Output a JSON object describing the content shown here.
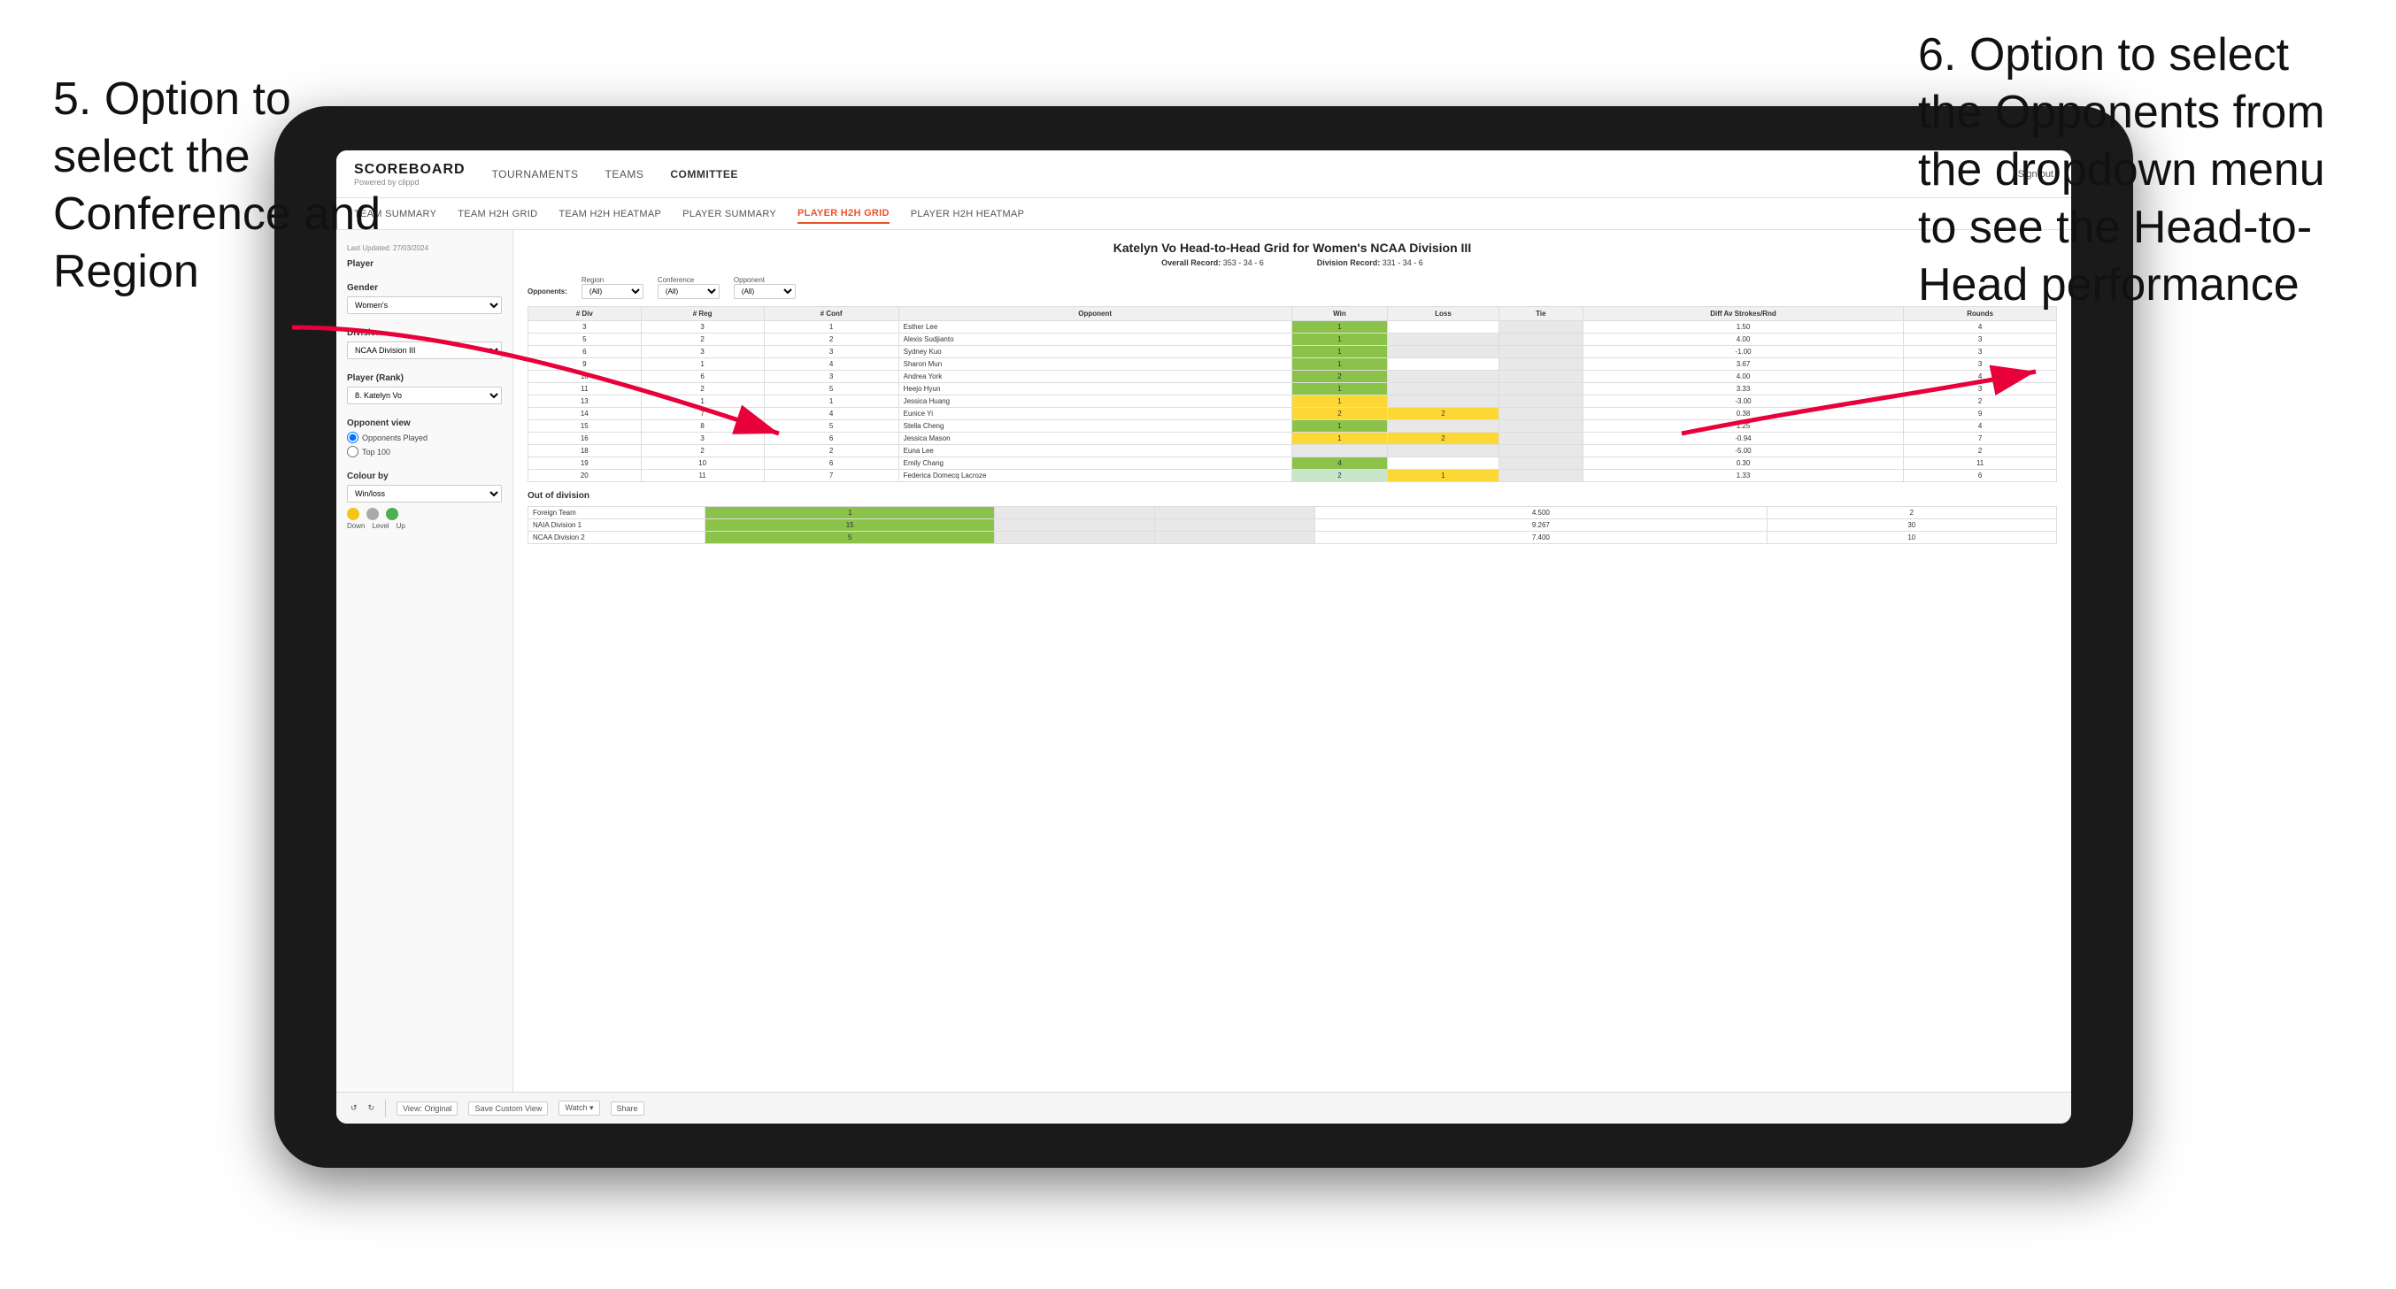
{
  "annotations": {
    "left": {
      "text": "5. Option to select the Conference and Region"
    },
    "right": {
      "text": "6. Option to select the Opponents from the dropdown menu to see the Head-to-Head performance"
    }
  },
  "nav": {
    "logo": "SCOREBOARD",
    "logo_sub": "Powered by clippd",
    "links": [
      "TOURNAMENTS",
      "TEAMS",
      "COMMITTEE"
    ],
    "active_link": "COMMITTEE",
    "sign_out": "Sign out"
  },
  "sub_nav": {
    "links": [
      "TEAM SUMMARY",
      "TEAM H2H GRID",
      "TEAM H2H HEATMAP",
      "PLAYER SUMMARY",
      "PLAYER H2H GRID",
      "PLAYER H2H HEATMAP"
    ],
    "active": "PLAYER H2H GRID"
  },
  "left_panel": {
    "last_updated_label": "Last Updated: 27/03/2024",
    "player_label": "Player",
    "gender_label": "Gender",
    "gender_value": "Women's",
    "division_label": "Division",
    "division_value": "NCAA Division III",
    "player_rank_label": "Player (Rank)",
    "player_rank_value": "8. Katelyn Vo",
    "opponent_view_label": "Opponent view",
    "radio_options": [
      "Opponents Played",
      "Top 100"
    ],
    "radio_selected": "Opponents Played",
    "colour_by_label": "Colour by",
    "colour_by_value": "Win/loss",
    "colour_labels": [
      "Down",
      "Level",
      "Up"
    ]
  },
  "data": {
    "title": "Katelyn Vo Head-to-Head Grid for Women's NCAA Division III",
    "overall_record_label": "Overall Record:",
    "overall_record": "353 - 34 - 6",
    "division_record_label": "Division Record:",
    "division_record": "331 - 34 - 6",
    "filter": {
      "opponents_label": "Opponents:",
      "region_label": "Region",
      "region_value": "(All)",
      "conference_label": "Conference",
      "conference_value": "(All)",
      "opponent_label": "Opponent",
      "opponent_value": "(All)"
    },
    "table_headers": [
      "# Div",
      "# Reg",
      "# Conf",
      "Opponent",
      "Win",
      "Loss",
      "Tie",
      "Diff Av Strokes/Rnd",
      "Rounds"
    ],
    "rows": [
      {
        "div": "3",
        "reg": "3",
        "conf": "1",
        "opponent": "Esther Lee",
        "win": "1",
        "loss": "",
        "tie": "",
        "diff": "1.50",
        "rounds": "4",
        "win_color": "green",
        "loss_color": "",
        "tie_color": "zero"
      },
      {
        "div": "5",
        "reg": "2",
        "conf": "2",
        "opponent": "Alexis Sudjianto",
        "win": "1",
        "loss": "",
        "tie": "",
        "diff": "4.00",
        "rounds": "3",
        "win_color": "green",
        "loss_color": "zero",
        "tie_color": "zero"
      },
      {
        "div": "6",
        "reg": "3",
        "conf": "3",
        "opponent": "Sydney Kuo",
        "win": "1",
        "loss": "",
        "tie": "",
        "diff": "-1.00",
        "rounds": "3",
        "win_color": "green",
        "loss_color": "zero",
        "tie_color": "zero"
      },
      {
        "div": "9",
        "reg": "1",
        "conf": "4",
        "opponent": "Sharon Mun",
        "win": "1",
        "loss": "",
        "tie": "",
        "diff": "3.67",
        "rounds": "3",
        "win_color": "green",
        "loss_color": "",
        "tie_color": ""
      },
      {
        "div": "10",
        "reg": "6",
        "conf": "3",
        "opponent": "Andrea York",
        "win": "2",
        "loss": "",
        "tie": "",
        "diff": "4.00",
        "rounds": "4",
        "win_color": "green",
        "loss_color": "zero",
        "tie_color": ""
      },
      {
        "div": "11",
        "reg": "2",
        "conf": "5",
        "opponent": "Heejo Hyun",
        "win": "1",
        "loss": "",
        "tie": "",
        "diff": "3.33",
        "rounds": "3",
        "win_color": "green",
        "loss_color": "zero",
        "tie_color": ""
      },
      {
        "div": "13",
        "reg": "1",
        "conf": "1",
        "opponent": "Jessica Huang",
        "win": "1",
        "loss": "",
        "tie": "",
        "diff": "-3.00",
        "rounds": "2",
        "win_color": "yellow",
        "loss_color": "zero",
        "tie_color": "zero"
      },
      {
        "div": "14",
        "reg": "7",
        "conf": "4",
        "opponent": "Eunice Yi",
        "win": "2",
        "loss": "2",
        "tie": "",
        "diff": "0.38",
        "rounds": "9",
        "win_color": "yellow",
        "loss_color": "yellow",
        "tie_color": "zero"
      },
      {
        "div": "15",
        "reg": "8",
        "conf": "5",
        "opponent": "Stella Cheng",
        "win": "1",
        "loss": "",
        "tie": "",
        "diff": "1.25",
        "rounds": "4",
        "win_color": "green",
        "loss_color": "zero",
        "tie_color": ""
      },
      {
        "div": "16",
        "reg": "3",
        "conf": "6",
        "opponent": "Jessica Mason",
        "win": "1",
        "loss": "2",
        "tie": "",
        "diff": "-0.94",
        "rounds": "7",
        "win_color": "yellow",
        "loss_color": "yellow",
        "tie_color": "zero"
      },
      {
        "div": "18",
        "reg": "2",
        "conf": "2",
        "opponent": "Euna Lee",
        "win": "",
        "loss": "",
        "tie": "",
        "diff": "-5.00",
        "rounds": "2",
        "win_color": "zero",
        "loss_color": "zero",
        "tie_color": "zero"
      },
      {
        "div": "19",
        "reg": "10",
        "conf": "6",
        "opponent": "Emily Chang",
        "win": "4",
        "loss": "",
        "tie": "",
        "diff": "0.30",
        "rounds": "11",
        "win_color": "green",
        "loss_color": "",
        "tie_color": ""
      },
      {
        "div": "20",
        "reg": "11",
        "conf": "7",
        "opponent": "Federica Domecq Lacroze",
        "win": "2",
        "loss": "1",
        "tie": "",
        "diff": "1.33",
        "rounds": "6",
        "win_color": "light-green",
        "loss_color": "yellow",
        "tie_color": "zero"
      }
    ],
    "out_of_division_title": "Out of division",
    "out_of_division_rows": [
      {
        "team": "Foreign Team",
        "win": "1",
        "loss": "",
        "tie": "",
        "diff": "4.500",
        "rounds": "2"
      },
      {
        "team": "NAIA Division 1",
        "win": "15",
        "loss": "",
        "tie": "",
        "diff": "9.267",
        "rounds": "30"
      },
      {
        "team": "NCAA Division 2",
        "win": "5",
        "loss": "",
        "tie": "",
        "diff": "7.400",
        "rounds": "10"
      }
    ]
  },
  "toolbar": {
    "undo": "↺",
    "redo": "↻",
    "view_original": "View: Original",
    "save_custom": "Save Custom View",
    "watch": "Watch ▾",
    "share": "Share"
  }
}
